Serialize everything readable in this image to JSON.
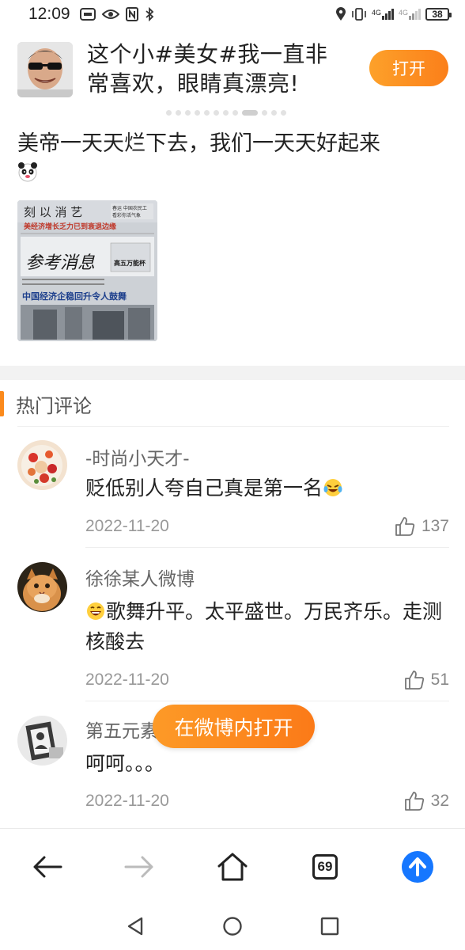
{
  "status_bar": {
    "time": "12:09",
    "battery": "38",
    "network_1": "4G",
    "network_2": "4G"
  },
  "banner": {
    "title": "这个小#美女#我一直非常喜欢，眼睛真漂亮!",
    "open_button": "打开"
  },
  "post": {
    "text": "美帝一天天烂下去，我们一天天好起来",
    "image_headline_top": "美经济增长乏力已到衰退边缘",
    "image_masthead": "参考消息",
    "image_headline_bottom": "中国经济企稳回升令人鼓舞",
    "image_side_label": "高五万能杯"
  },
  "hot_comments": {
    "title": "热门评论",
    "items": [
      {
        "name": "-时尚小天才-",
        "text": "贬低别人夸自己真是第一名",
        "date": "2022-11-20",
        "likes": "137"
      },
      {
        "name": "徐徐某人微博",
        "text": "歌舞升平。太平盛世。万民齐乐。走测核酸去",
        "date": "2022-11-20",
        "likes": "51"
      },
      {
        "name": "第五元素",
        "text": "呵呵。。。",
        "date": "2022-11-20",
        "likes": "32"
      }
    ]
  },
  "floating_button": "在微博内打开",
  "browser_bar": {
    "tab_count": "69"
  },
  "colors": {
    "accent_orange": "#fb8a1c",
    "upload_blue": "#1677ff"
  }
}
